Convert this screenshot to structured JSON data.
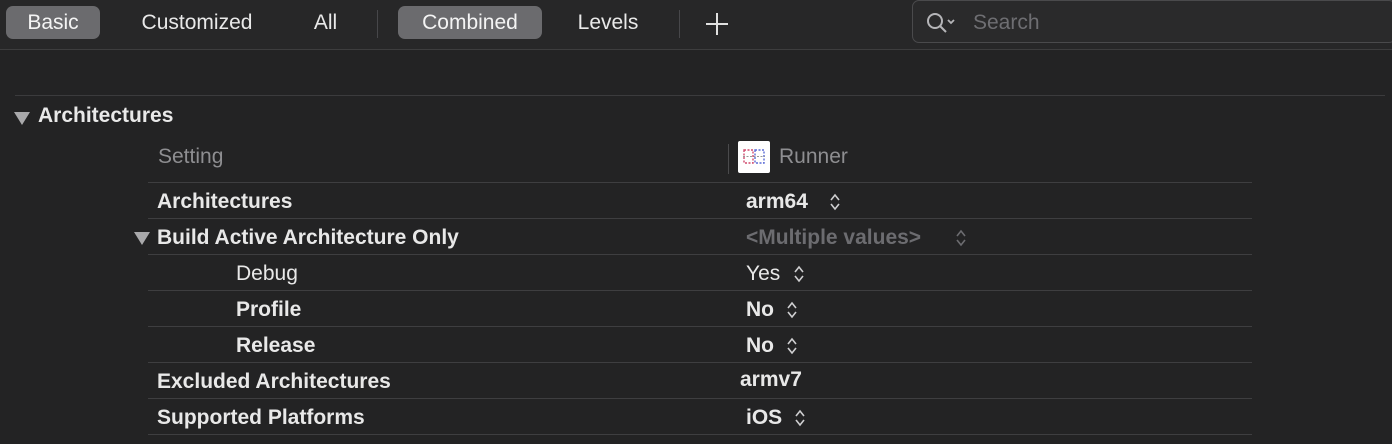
{
  "toolbar": {
    "filters": [
      "Basic",
      "Customized",
      "All"
    ],
    "views": [
      "Combined",
      "Levels"
    ],
    "active_filter": "Basic",
    "active_view": "Combined"
  },
  "search": {
    "placeholder": "Search"
  },
  "section": {
    "title": "Architectures"
  },
  "columns": {
    "setting": "Setting",
    "target": "Runner"
  },
  "rows": {
    "architectures": {
      "label": "Architectures",
      "value": "arm64"
    },
    "build_active": {
      "label": "Build Active Architecture Only",
      "value": "<Multiple values>"
    },
    "debug": {
      "label": "Debug",
      "value": "Yes"
    },
    "profile": {
      "label": "Profile",
      "value": "No"
    },
    "release": {
      "label": "Release",
      "value": "No"
    },
    "excluded": {
      "label": "Excluded Architectures",
      "value": "armv7"
    },
    "platforms": {
      "label": "Supported Platforms",
      "value": "iOS"
    }
  },
  "colors": {
    "background": "#232324",
    "active_segment": "#6b6b6e",
    "muted_text": "#6c6c70"
  },
  "icons": [
    "plus-icon",
    "search-icon",
    "disclosure-triangle-icon",
    "stepper-icon",
    "target-app-icon"
  ]
}
